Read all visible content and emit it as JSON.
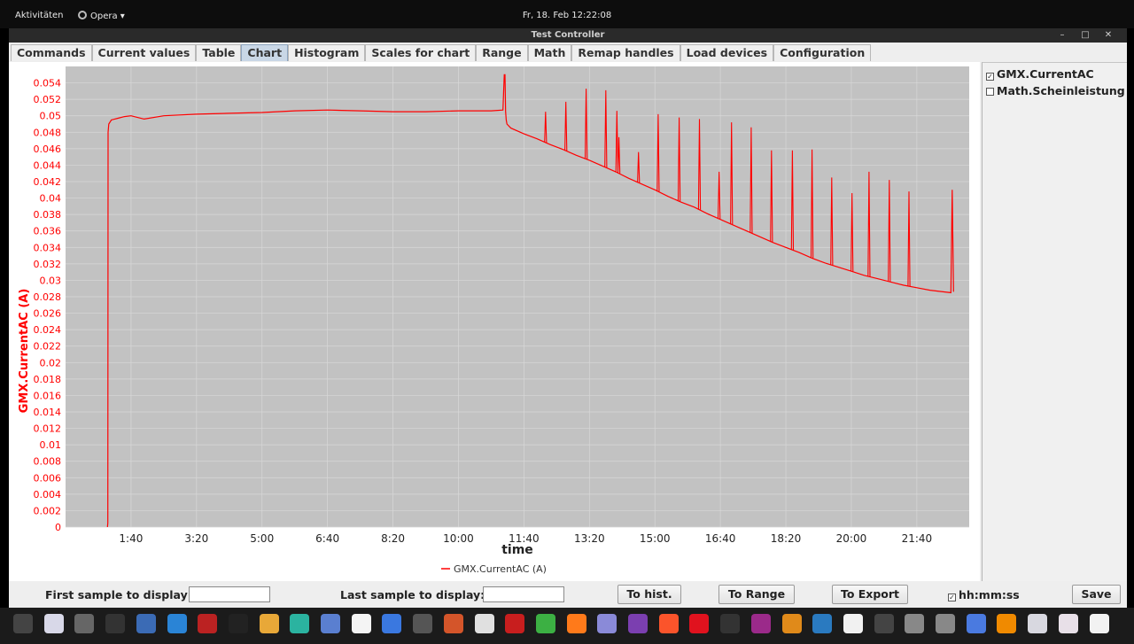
{
  "topbar": {
    "activities": "Aktivitäten",
    "app_name": "Opera ▾",
    "clock": "Fr, 18. Feb  12:22:08"
  },
  "window": {
    "title": "Test Controller",
    "controls": [
      "–",
      "□",
      "✕"
    ]
  },
  "tabs": [
    {
      "label": "Commands",
      "active": false
    },
    {
      "label": "Current values",
      "active": false
    },
    {
      "label": "Table",
      "active": false
    },
    {
      "label": "Chart",
      "active": true
    },
    {
      "label": "Histogram",
      "active": false
    },
    {
      "label": "Scales for chart",
      "active": false
    },
    {
      "label": "Range",
      "active": false
    },
    {
      "label": "Math",
      "active": false
    },
    {
      "label": "Remap handles",
      "active": false
    },
    {
      "label": "Load devices",
      "active": false
    },
    {
      "label": "Configuration",
      "active": false
    }
  ],
  "chart_data": {
    "type": "line",
    "ylabel": "GMX.CurrentAC (A)",
    "xlabel": "time",
    "ylim": [
      0,
      0.056
    ],
    "yticks": [
      "0",
      "0.002",
      "0.004",
      "0.006",
      "0.008",
      "0.01",
      "0.012",
      "0.014",
      "0.016",
      "0.018",
      "0.02",
      "0.022",
      "0.024",
      "0.026",
      "0.028",
      "0.03",
      "0.032",
      "0.034",
      "0.036",
      "0.038",
      "0.04",
      "0.042",
      "0.044",
      "0.046",
      "0.048",
      "0.05",
      "0.052",
      "0.054"
    ],
    "xlim_minutes": [
      0,
      1380
    ],
    "xticks": [
      "1:40",
      "3:20",
      "5:00",
      "6:40",
      "8:20",
      "10:00",
      "11:40",
      "13:20",
      "15:00",
      "16:40",
      "18:20",
      "20:00",
      "21:40"
    ],
    "xtick_minutes": [
      100,
      200,
      300,
      400,
      500,
      600,
      700,
      800,
      900,
      1000,
      1100,
      1200,
      1300
    ],
    "grid": true,
    "legend": "bottom-center",
    "series": [
      {
        "name": "GMX.CurrentAC (A)",
        "color": "#ff0000",
        "x_minutes": [
          64,
          64.5,
          65,
          66,
          70,
          80,
          90,
          100,
          110,
          120,
          150,
          200,
          250,
          300,
          350,
          400,
          450,
          500,
          550,
          600,
          650,
          668,
          670,
          671,
          672,
          673,
          674,
          680,
          700,
          720,
          740,
          760,
          780,
          800,
          820,
          840,
          860,
          880,
          900,
          920,
          940,
          960,
          980,
          1000,
          1020,
          1040,
          1060,
          1080,
          1100,
          1120,
          1140,
          1160,
          1180,
          1200,
          1220,
          1240,
          1260,
          1280,
          1300,
          1320,
          1340,
          1352,
          1354,
          1356
        ],
        "values": [
          0,
          0.0005,
          0.048,
          0.049,
          0.0495,
          0.0497,
          0.0499,
          0.05,
          0.0498,
          0.0496,
          0.05,
          0.0502,
          0.0503,
          0.0504,
          0.0506,
          0.0507,
          0.0506,
          0.0505,
          0.0505,
          0.0506,
          0.0506,
          0.0507,
          0.055,
          0.055,
          0.0505,
          0.0495,
          0.049,
          0.0485,
          0.0478,
          0.0472,
          0.0465,
          0.0459,
          0.0452,
          0.0446,
          0.0439,
          0.0432,
          0.0424,
          0.0417,
          0.041,
          0.0402,
          0.0395,
          0.0389,
          0.0381,
          0.0374,
          0.0367,
          0.036,
          0.0353,
          0.0346,
          0.034,
          0.0334,
          0.0327,
          0.0321,
          0.0316,
          0.0311,
          0.0306,
          0.0302,
          0.0298,
          0.0294,
          0.0291,
          0.0288,
          0.0286,
          0.0285,
          0.041,
          0.0286
        ]
      }
    ],
    "spikes": [
      {
        "x_minutes": 733,
        "value": 0.0505
      },
      {
        "x_minutes": 764,
        "value": 0.0517
      },
      {
        "x_minutes": 795,
        "value": 0.0533
      },
      {
        "x_minutes": 825,
        "value": 0.0531
      },
      {
        "x_minutes": 842,
        "value": 0.0506
      },
      {
        "x_minutes": 845,
        "value": 0.0474
      },
      {
        "x_minutes": 875,
        "value": 0.0456
      },
      {
        "x_minutes": 905,
        "value": 0.0502
      },
      {
        "x_minutes": 937,
        "value": 0.0498
      },
      {
        "x_minutes": 968,
        "value": 0.0496
      },
      {
        "x_minutes": 998,
        "value": 0.0432
      },
      {
        "x_minutes": 1017,
        "value": 0.0492
      },
      {
        "x_minutes": 1047,
        "value": 0.0486
      },
      {
        "x_minutes": 1078,
        "value": 0.0458
      },
      {
        "x_minutes": 1110,
        "value": 0.0458
      },
      {
        "x_minutes": 1140,
        "value": 0.0459
      },
      {
        "x_minutes": 1170,
        "value": 0.0425
      },
      {
        "x_minutes": 1201,
        "value": 0.0406
      },
      {
        "x_minutes": 1227,
        "value": 0.0432
      },
      {
        "x_minutes": 1258,
        "value": 0.0422
      },
      {
        "x_minutes": 1288,
        "value": 0.0408
      }
    ]
  },
  "side_panel": {
    "series": [
      {
        "label": "GMX.CurrentAC",
        "checked": true
      },
      {
        "label": "Math.Scheinleistung",
        "checked": false
      }
    ]
  },
  "legend_label": "GMX.CurrentAC (A)",
  "bottom": {
    "first_sample_label": "First sample to display:",
    "first_sample_value": "",
    "last_sample_label": "Last sample to display:",
    "last_sample_value": "",
    "to_hist": "To hist.",
    "to_range": "To Range",
    "to_export": "To Export",
    "hhmmss_label": "hh:mm:ss",
    "hhmmss_checked": true,
    "save": "Save"
  },
  "dock": {
    "icons": [
      "apps-grid-icon",
      "appimage-icon",
      "obs-icon",
      "monitor-icon",
      "virtualbox-icon",
      "vscode-icon",
      "wine-icon",
      "terminal-icon",
      "app-icon",
      "calendar-icon",
      "mail-icon",
      "document-icon",
      "notes-icon",
      "files-icon",
      "archive-icon",
      "finder-icon",
      "filezilla-icon",
      "android-icon",
      "firefox-icon",
      "app-icon",
      "tor-icon",
      "brave-icon",
      "opera-icon",
      "python-icon",
      "winrar-icon",
      "app-icon",
      "kodi-icon",
      "audacity-icon",
      "app-icon",
      "calc-icon",
      "calc-icon",
      "window-icon",
      "vlc-icon",
      "disk-icon",
      "chart-icon",
      "testcontroller-icon"
    ]
  }
}
